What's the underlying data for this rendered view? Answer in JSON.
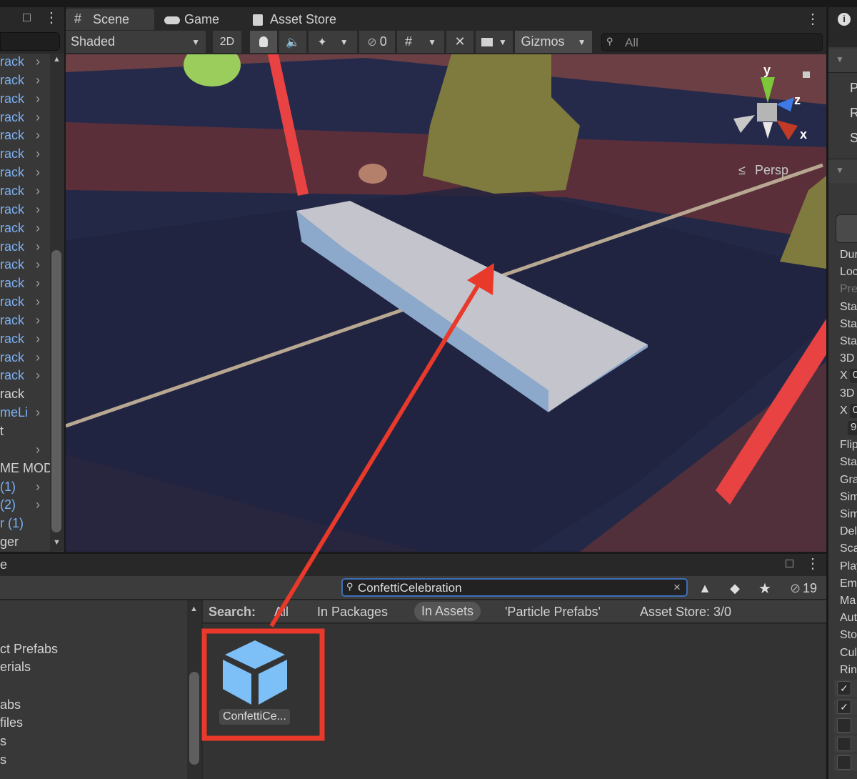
{
  "hierarchy": {
    "items": [
      {
        "label": "rack",
        "blue": true,
        "chevron": true
      },
      {
        "label": "rack",
        "blue": true,
        "chevron": true
      },
      {
        "label": "rack",
        "blue": true,
        "chevron": true
      },
      {
        "label": "rack",
        "blue": true,
        "chevron": true
      },
      {
        "label": "rack",
        "blue": true,
        "chevron": true
      },
      {
        "label": "rack",
        "blue": true,
        "chevron": true
      },
      {
        "label": "rack",
        "blue": true,
        "chevron": true
      },
      {
        "label": "rack",
        "blue": true,
        "chevron": true
      },
      {
        "label": "rack",
        "blue": true,
        "chevron": true
      },
      {
        "label": "rack",
        "blue": true,
        "chevron": true
      },
      {
        "label": "rack",
        "blue": true,
        "chevron": true
      },
      {
        "label": "rack",
        "blue": true,
        "chevron": true
      },
      {
        "label": "rack",
        "blue": true,
        "chevron": true
      },
      {
        "label": "rack",
        "blue": true,
        "chevron": true
      },
      {
        "label": "rack",
        "blue": true,
        "chevron": true
      },
      {
        "label": "rack",
        "blue": true,
        "chevron": true
      },
      {
        "label": "rack",
        "blue": true,
        "chevron": true
      },
      {
        "label": "rack",
        "blue": true,
        "chevron": true
      },
      {
        "label": "rack",
        "blue": false,
        "chevron": false
      },
      {
        "label": "meLi",
        "blue": true,
        "chevron": true
      },
      {
        "label": "t",
        "blue": false,
        "chevron": false
      },
      {
        "label": "",
        "blue": false,
        "chevron": true
      },
      {
        "label": "ME MOD",
        "blue": false,
        "chevron": false
      },
      {
        "label": "(1)",
        "blue": true,
        "chevron": true
      },
      {
        "label": "(2)",
        "blue": true,
        "chevron": true
      },
      {
        "label": "r (1)",
        "blue": true,
        "chevron": false
      },
      {
        "label": "ger",
        "blue": false,
        "chevron": false
      }
    ]
  },
  "scene": {
    "tabs": [
      {
        "label": "Scene",
        "icon": "grid-hash-icon",
        "active": true
      },
      {
        "label": "Game",
        "icon": "gamepad-icon",
        "active": false
      },
      {
        "label": "Asset Store",
        "icon": "shopping-bag-icon",
        "active": false
      }
    ],
    "toolbar": {
      "shading_mode": "Shaded",
      "two_d_label": "2D",
      "hidden_count": "0",
      "gizmos_label": "Gizmos",
      "search_placeholder": "All"
    },
    "gizmo": {
      "y": "y",
      "z": "z",
      "x": "x",
      "projection": "Persp"
    }
  },
  "inspector": {
    "transform_rows": [
      "P",
      "R",
      "S"
    ],
    "rows": [
      {
        "label": "Dur"
      },
      {
        "label": "Loc"
      },
      {
        "label": "Pre",
        "disabled": true
      },
      {
        "label": "Sta"
      },
      {
        "label": "Sta"
      },
      {
        "label": "Sta"
      },
      {
        "label": "3D"
      },
      {
        "label": "X",
        "field": "0"
      },
      {
        "label": "3D"
      },
      {
        "label": "X",
        "field": "0"
      },
      {
        "label": "",
        "field": "9"
      },
      {
        "label": "Flip"
      },
      {
        "label": "Sta"
      },
      {
        "label": "Gra"
      },
      {
        "label": "Sim"
      },
      {
        "label": "Sim"
      },
      {
        "label": "Del"
      },
      {
        "label": "Sca"
      },
      {
        "label": "Play"
      },
      {
        "label": "Em"
      },
      {
        "label": "Ma"
      },
      {
        "label": "Aut"
      },
      {
        "label": "Sto"
      },
      {
        "label": "Cul"
      },
      {
        "label": "Rin"
      }
    ],
    "checkboxes": [
      true,
      true,
      false,
      false,
      false
    ]
  },
  "project": {
    "title_fragment": "e",
    "search_value": "ConfettiCelebration",
    "hidden_packages_count": "19",
    "search_bar": {
      "label": "Search:",
      "scopes": [
        {
          "label": "All",
          "active": false
        },
        {
          "label": "In Packages",
          "active": false
        },
        {
          "label": "In Assets",
          "active": true
        },
        {
          "label": "'Particle Prefabs'",
          "active": false
        },
        {
          "label": "Asset Store: 3/0",
          "active": false
        }
      ]
    },
    "tree": [
      "ct Prefabs",
      "erials",
      "",
      "abs",
      "files",
      "s",
      "s"
    ],
    "assets": [
      {
        "label": "ConfettiCe...",
        "icon": "prefab-cube-icon",
        "color": "#7dbff7"
      }
    ]
  },
  "annotation": {
    "color": "#e8392a"
  }
}
